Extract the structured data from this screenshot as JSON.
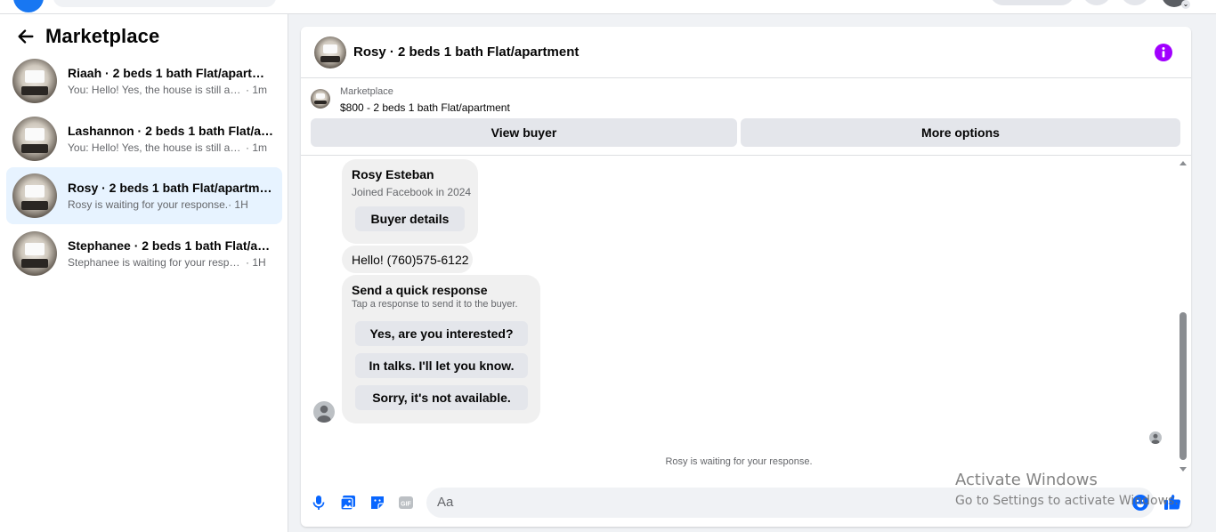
{
  "left_panel": {
    "title": "Marketplace",
    "conversations": [
      {
        "name": "Riaah · 2 beds 1 bath Flat/apartment",
        "snippet": "You: Hello! Yes, the house is still avail...",
        "time": " · 1m"
      },
      {
        "name": "Lashannon · 2 beds 1 bath Flat/apa...",
        "snippet": "You: Hello! Yes, the house is still avail...",
        "time": " · 1m"
      },
      {
        "name": "Rosy · 2 beds 1 bath Flat/apartment",
        "snippet": "Rosy is waiting for your response.",
        "time": " · 1H"
      },
      {
        "name": "Stephanee · 2 beds 1 bath Flat/apa...",
        "snippet": "Stephanee is waiting for your response.",
        "time": " · 1H"
      }
    ]
  },
  "chat": {
    "title": "Rosy · 2 beds 1 bath Flat/apartment",
    "listing_source": "Marketplace",
    "listing_item": "$800 - 2 beds 1 bath Flat/apartment",
    "view_buyer_label": "View buyer",
    "more_options_label": "More options",
    "buyer_card": {
      "name": "Rosy Esteban",
      "meta": "Joined Facebook in 2024",
      "button_label": "Buyer details"
    },
    "incoming_message": "Hello! (760)575-6122",
    "quick_response": {
      "title": "Send a quick response",
      "subtitle": "Tap a response to send it to the buyer.",
      "options": [
        "Yes, are you interested?",
        "In talks. I'll let you know.",
        "Sorry, it's not available."
      ]
    },
    "waiting_note": "Rosy is waiting for your response.",
    "composer_placeholder": "Aa"
  },
  "watermark": {
    "line1": "Activate Windows",
    "line2": "Go to Settings to activate Windows."
  },
  "colors": {
    "accent": "#1877f2",
    "info_purple": "#a100ff",
    "active_row": "#e7f3ff"
  }
}
